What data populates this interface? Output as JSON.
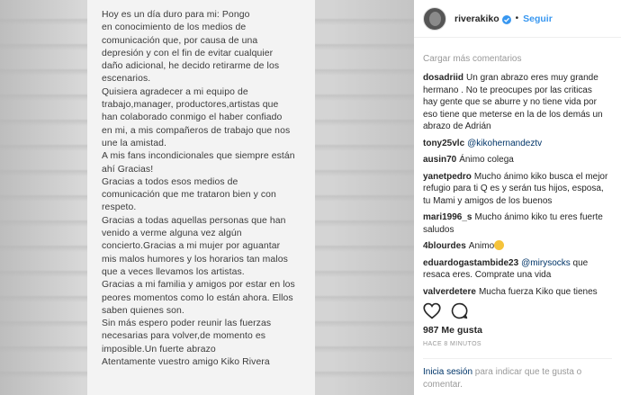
{
  "post_image": {
    "text": "Hoy es un día duro para mi: Pongo\nen conocimiento de los medios de\ncomunicación que, por causa de una\ndepresión y con el fin de evitar cualquier\ndaño adicional, he decido retirarme de los\nescenarios.\nQuisiera agradecer a mi equipo de\ntrabajo,manager, productores,artistas que\nhan colaborado conmigo el haber confiado\nen mi, a mis compañeros de trabajo que nos\nune la amistad.\nA mis fans incondicionales que siempre están\nahí Gracias!\nGracias a todos esos medios de\ncomunicación que me trataron bien y con\nrespeto.\nGracias a todas aquellas personas que han\nvenido a verme alguna vez algún\nconcierto.Gracias a mi mujer por aguantar\nmis malos humores y los horarios tan malos\nque a veces llevamos los artistas.\nGracias a mi familia y amigos por estar en los\npeores momentos como lo están ahora. Ellos\nsaben quienes son.\nSin más espero poder reunir las fuerzas\nnecesarias para volver,de momento es\nimposible.Un fuerte abrazo\nAtentamente vuestro amigo Kiko Rivera"
  },
  "header": {
    "username": "riverakiko",
    "separator": "•",
    "follow_label": "Seguir"
  },
  "comments": {
    "load_more": "Cargar más comentarios",
    "items": [
      {
        "user": "dosadriid",
        "pre": "Un gran abrazo eres muy grande hermano . No te preocupes por las criticas hay gente que se aburre y no tiene vida por eso tiene que meterse en la de los demás un abrazo de Adrián",
        "mention": "",
        "post": ""
      },
      {
        "user": "tony25vlc",
        "pre": "",
        "mention": "@kikohernandeztv",
        "post": ""
      },
      {
        "user": "ausin70",
        "pre": "Ánimo colega",
        "mention": "",
        "post": ""
      },
      {
        "user": "yanetpedro",
        "pre": "Mucho ánimo kiko busca el mejor refugio para ti Q es y serán tus hijos, esposa, tu Mami y amigos de los buenos",
        "mention": "",
        "post": ""
      },
      {
        "user": "mari1996_s",
        "pre": "Mucho ánimo kiko tu eres fuerte saludos",
        "mention": "",
        "post": ""
      },
      {
        "user": "4blourdes",
        "pre": "Animo",
        "mention": "",
        "post": ""
      },
      {
        "user": "eduardogastambide23",
        "pre": "",
        "mention": "@mirysocks",
        "post": " que resaca eres. Comprate una vida"
      },
      {
        "user": "valverdetere",
        "pre": "Mucha fuerza Kiko que tienes",
        "mention": "",
        "post": ""
      }
    ]
  },
  "footer": {
    "likes": "987 Me gusta",
    "time": "HACE 8 MINUTOS",
    "login_link": "Inicia sesión",
    "login_text": " para indicar que te gusta o comentar."
  }
}
